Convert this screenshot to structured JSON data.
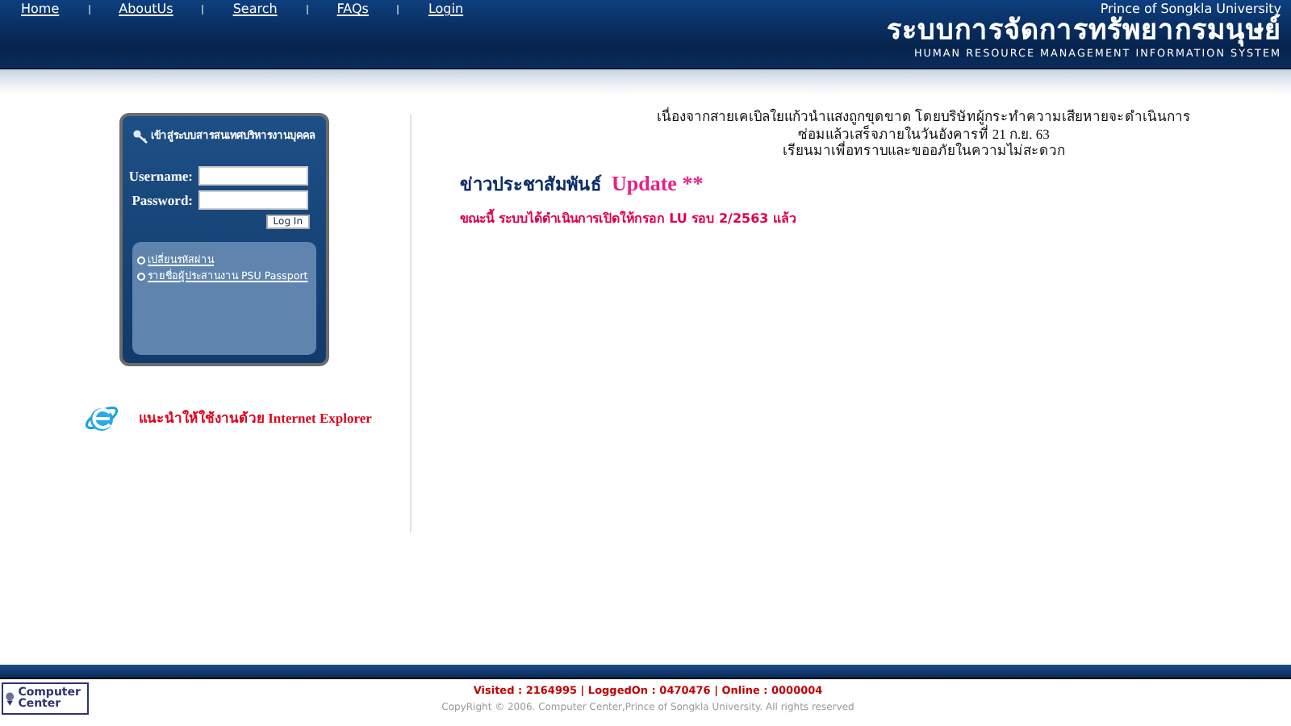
{
  "nav": [
    {
      "label": "Home"
    },
    {
      "label": "AboutUs"
    },
    {
      "label": "Search"
    },
    {
      "label": "FAQs"
    },
    {
      "label": "Login"
    }
  ],
  "header": {
    "university": "Prince of Songkla University",
    "title_th": "ระบบการจัดการทรัพยากรมนุษย์",
    "title_en": "HUMAN RESOURCE MANAGEMENT INFORMATION SYSTEM"
  },
  "login": {
    "title": "เข้าสู่ระบบสารสนเทศบริหารงานบุคคล",
    "username_label": "Username:",
    "password_label": "Password:",
    "button": "Log In",
    "links": [
      "เปลี่ยนรหัสผ่าน",
      "รายชื่อผู้ประสานงาน PSU Passport"
    ]
  },
  "browser_note": "แนะนำให้ใช้งานด้วย Internet Explorer",
  "notice": [
    "เนื่องจากสายเคเบิลใยแก้วนำแสงถูกขุดขาด โดยบริษัทผู้กระทำความเสียหายจะดำเนินการ",
    "ซ่อมแล้วเสร็จภายในวันอังคารที่ 21 ก.ย. 63",
    "เรียนมาเพื่อทราบและขออภัยในความไม่สะดวก"
  ],
  "news": {
    "title": "ข่าวประชาสัมพันธ์",
    "badge": "Update **",
    "items": [
      "ขณะนี้ ระบบได้ดำเนินการเปิดให้กรอก LU รอบ 2/2563 แล้ว"
    ]
  },
  "footer": {
    "logo": "Computer Center",
    "stats": "Visited : 2164995 | LoggedOn : 0470476 | Online : 0000004",
    "copyright": "CopyRight © 2006. Computer Center,Prince of Songkla University. All rights reserved"
  }
}
